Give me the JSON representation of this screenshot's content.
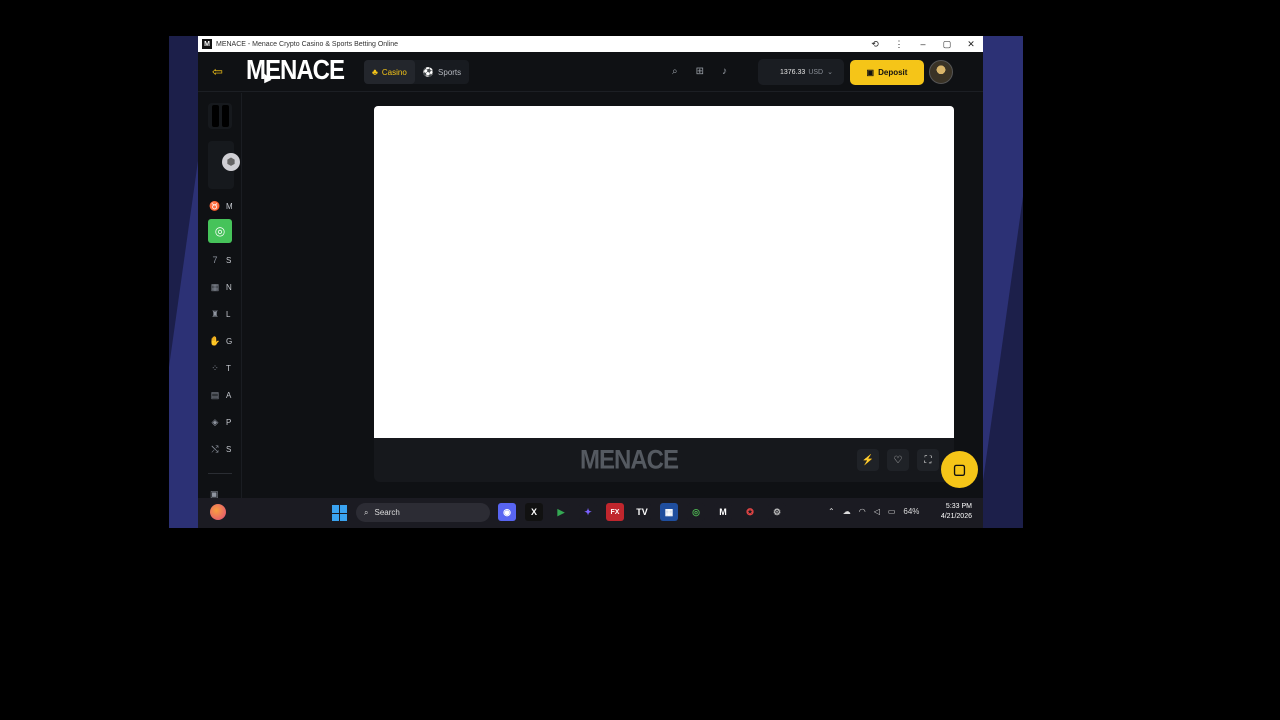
{
  "window": {
    "favicon": "M",
    "title": "MENACE - Menace Crypto Casino & Sports Betting Online",
    "controls": [
      "⟲",
      "⋮",
      "–",
      "▢",
      "✕"
    ]
  },
  "header": {
    "logo": "MENACE",
    "tabs": [
      {
        "label": "Casino",
        "icon": "casino-icon",
        "active": true
      },
      {
        "label": "Sports",
        "icon": "soccer-ball-icon",
        "active": false
      }
    ],
    "icons": [
      "search-icon",
      "gift-icon",
      "bell-icon"
    ],
    "balance": {
      "amount": "1376.33",
      "currency": "USD"
    },
    "deposit_label": "Deposit"
  },
  "sidebar": {
    "items": [
      {
        "icon": "cow-icon",
        "label": "M"
      },
      {
        "icon": "chips-icon",
        "label": ""
      },
      {
        "icon": "seven-icon",
        "label": "S"
      },
      {
        "icon": "grid-icon",
        "label": "N"
      },
      {
        "icon": "jersey-icon",
        "label": "L"
      },
      {
        "icon": "hand-icon",
        "label": "G"
      },
      {
        "icon": "dots-icon",
        "label": "T"
      },
      {
        "icon": "slots-icon",
        "label": "A"
      },
      {
        "icon": "box-icon",
        "label": "P"
      },
      {
        "icon": "shuffle-icon",
        "label": "S"
      }
    ]
  },
  "game": {
    "logo": "MENACE",
    "controls": [
      "bolt-icon",
      "heart-icon",
      "fullscreen-icon"
    ]
  },
  "taskbar": {
    "search_placeholder": "Search",
    "battery": "64%",
    "time": "5:33 PM",
    "date": "4/21/2026"
  },
  "colors": {
    "accent": "#f5c518",
    "background": "#0f1114",
    "sidebar_active": "#46c35a"
  }
}
